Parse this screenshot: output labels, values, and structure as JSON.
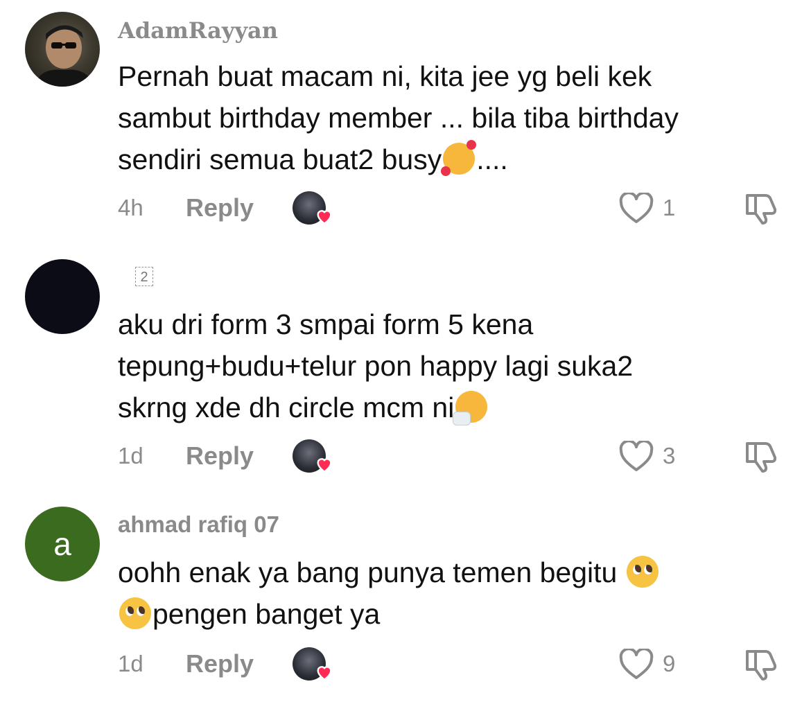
{
  "comments": [
    {
      "username": "AdamRayyan",
      "avatar": "profile-photo",
      "lines": [
        "Pernah buat macam ni, kita jee yg beli kek",
        "sambut birthday member ... bila tiba birthday",
        "sendiri semua buat2 busy"
      ],
      "line3_suffix": "....",
      "emoji": "smiling-face-with-hearts-emoji",
      "time": "4h",
      "reply_label": "Reply",
      "likes": "1"
    },
    {
      "username_glyph": "2",
      "avatar": "dark-avatar",
      "lines": [
        "aku dri form 3 smpai form 5 kena",
        "tepung+budu+telur pon happy lagi suka2",
        "skrng xde dh circle mcm ni"
      ],
      "emoji": "sneezing-face-emoji",
      "time": "1d",
      "reply_label": "Reply",
      "likes": "3"
    },
    {
      "username": "ahmad rafiq 07",
      "avatar_letter": "a",
      "lines": [
        "oohh enak ya bang punya temen begitu",
        "pengen banget ya"
      ],
      "emoji": "pleading-face-emoji",
      "time": "1d",
      "reply_label": "Reply",
      "likes": "9"
    }
  ],
  "colors": {
    "secondary_text": "#8a8a8a",
    "creator_heart": "#fe2c55",
    "avatar_green": "#3b6b1e"
  },
  "icons": [
    "heart-outline-icon",
    "thumbs-down-icon",
    "creator-liked-heart-icon"
  ]
}
